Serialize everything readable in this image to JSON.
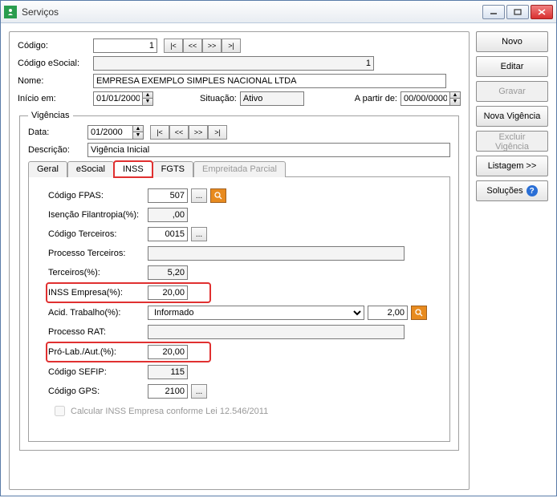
{
  "window": {
    "title": "Serviços"
  },
  "sidebar": {
    "novo": "Novo",
    "editar": "Editar",
    "gravar": "Gravar",
    "nova_vigencia": "Nova Vigência",
    "excluir_vigencia": "Excluir Vigência",
    "listagem": "Listagem >>",
    "solucoes": "Soluções"
  },
  "header": {
    "codigo_label": "Código:",
    "codigo_value": "1",
    "codigo_esocial_label": "Código eSocial:",
    "codigo_esocial_value": "1",
    "nome_label": "Nome:",
    "nome_value": "EMPRESA EXEMPLO SIMPLES NACIONAL LTDA",
    "inicio_label": "Início em:",
    "inicio_value": "01/01/2000",
    "situacao_label": "Situação:",
    "situacao_value": "Ativo",
    "apartir_label": "A partir de:",
    "apartir_value": "00/00/0000"
  },
  "navbtns": {
    "first": "|<",
    "prev": "<<",
    "next": ">>",
    "last": ">|"
  },
  "vigencias": {
    "legend": "Vigências",
    "data_label": "Data:",
    "data_value": "01/2000",
    "descricao_label": "Descrição:",
    "descricao_value": "Vigência Inicial"
  },
  "tabs": {
    "geral": "Geral",
    "esocial": "eSocial",
    "inss": "INSS",
    "fgts": "FGTS",
    "empreitada": "Empreitada Parcial"
  },
  "inss": {
    "codigo_fpas_label": "Código FPAS:",
    "codigo_fpas_value": "507",
    "isencao_label": "Isenção Filantropia(%):",
    "isencao_value": ",00",
    "codigo_terceiros_label": "Código Terceiros:",
    "codigo_terceiros_value": "0015",
    "processo_terceiros_label": "Processo Terceiros:",
    "processo_terceiros_value": "",
    "terceiros_pct_label": "Terceiros(%):",
    "terceiros_pct_value": "5,20",
    "inss_empresa_label": "INSS Empresa(%):",
    "inss_empresa_value": "20,00",
    "acid_trabalho_label": "Acid. Trabalho(%):",
    "acid_trabalho_select": "Informado",
    "acid_trabalho_value": "2,00",
    "processo_rat_label": "Processo RAT:",
    "processo_rat_value": "",
    "prolab_label": "Pró-Lab./Aut.(%):",
    "prolab_value": "20,00",
    "codigo_sefip_label": "Código SEFIP:",
    "codigo_sefip_value": "115",
    "codigo_gps_label": "Código GPS:",
    "codigo_gps_value": "2100",
    "calc_inss_label": "Calcular INSS Empresa conforme Lei 12.546/2011"
  }
}
